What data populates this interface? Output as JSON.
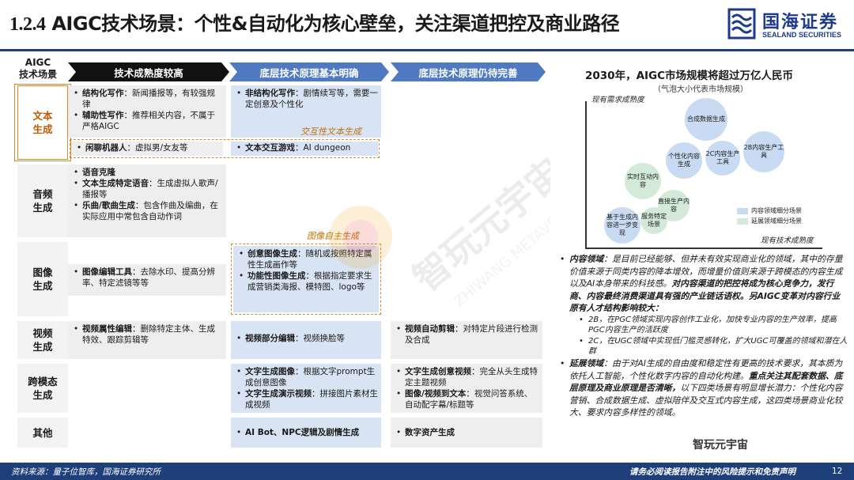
{
  "title": {
    "num": "1.2.4",
    "text": "AIGC技术场景：个性&自动化为核心壁垒，关注渠道把控及商业路径"
  },
  "logo": {
    "cn": "国海证券",
    "en": "SEALAND SECURITIES"
  },
  "table": {
    "corner_label": "AIGC\n技术场景",
    "columns": [
      "技术成熟度较高",
      "底层技术原理基本明确",
      "底层技术原理仍待完善"
    ],
    "rows": [
      "文本\n生成",
      "音频\n生成",
      "图像\n生成",
      "视频\n生成",
      "跨模态\n生成",
      "其他"
    ],
    "text_gen": {
      "c1_items": [
        {
          "bold": "结构化写作",
          "text": "：新闻播报等，有较强规律"
        },
        {
          "bold": "辅助性写作",
          "text": "：推荐相关内容，不属于严格AIGC"
        }
      ],
      "c1_chat": {
        "bold": "闲聊机器人",
        "text": "：虚拟男/女友等"
      },
      "c2_items": [
        {
          "bold": "非结构化写作",
          "text": "：剧情续写等，需要一定创意及个性化"
        }
      ],
      "c2_game": {
        "bold": "文本交互游戏",
        "text": "：AI dungeon"
      },
      "interactive_label": "交互性文本生成"
    },
    "audio_gen": {
      "c1_items": [
        {
          "bold": "语音克隆",
          "text": ""
        },
        {
          "bold": "文本生成特定语音",
          "text": "：生成虚拟人歌声/播报等"
        },
        {
          "bold": "乐曲/歌曲生成",
          "text": "：包含作曲及编曲，在实际应用中常包含自动作词"
        }
      ]
    },
    "image_gen": {
      "auto_label": "图像自主生成",
      "c1_items": [
        {
          "bold": "图像编辑工具",
          "text": "：去除水印、提高分辨率、特定滤镜等等"
        }
      ],
      "c2_items": [
        {
          "bold": "创意图像生成",
          "text": "：随机或按照特定属性生成画作等"
        },
        {
          "bold": "功能性图像生成",
          "text": "：根据指定要求生成营销类海报、模特图、logo等"
        }
      ]
    },
    "video_gen": {
      "c1_items": [
        {
          "bold": "视频属性编辑",
          "text": "：删除特定主体、生成特效、跟踪剪辑等"
        }
      ],
      "c2_items": [
        {
          "bold": "视频部分编辑",
          "text": "：视频换脸等"
        }
      ],
      "c3_items": [
        {
          "bold": "视频自动剪辑",
          "text": "：对特定片段进行检测及合成"
        }
      ]
    },
    "cross_gen": {
      "c2_items": [
        {
          "bold": "文字生成图像",
          "text": "：根据文字prompt生成创意图像"
        },
        {
          "bold": "文字生成演示视频",
          "text": "：拼接图片素材生成视频"
        }
      ],
      "c3_items": [
        {
          "bold": "文字生成创意视频",
          "text": "：完全从头生成特定主题视频"
        },
        {
          "bold": "图像/视频到文本",
          "text": "：视觉问答系统、自动配字幕/标题等"
        }
      ]
    },
    "other": {
      "c2_items": [
        {
          "bold": "AI Bot、NPC逻辑及剧情生成",
          "text": ""
        }
      ],
      "c3_items": [
        {
          "bold": "数字资产生成",
          "text": ""
        }
      ]
    }
  },
  "chart": {
    "title": "2030年，AIGC市场规模将超过万亿人民币",
    "subtitle": "（气泡大小代表市场规模）",
    "ylabel": "现有需求成熟度",
    "xlabel": "现有技术成熟度",
    "legend": [
      "内容领域细分场景",
      "延展领域细分场景"
    ],
    "colors": {
      "content": "#c9dbf2",
      "extend": "#d4ead8"
    }
  },
  "chart_data": {
    "type": "scatter",
    "title": "2030年，AIGC市场规模将超过万亿人民币",
    "subtitle": "（气泡大小代表市场规模）",
    "xlabel": "现有技术成熟度",
    "ylabel": "现有需求成熟度",
    "series": [
      {
        "name": "内容领域细分场景",
        "points": [
          {
            "label": "合成数据生成"
          },
          {
            "label": "2B内容生产工具"
          },
          {
            "label": "个性化内容生成"
          },
          {
            "label": "2C内容生产工具"
          },
          {
            "label": "基于生成内容进一步变现"
          }
        ]
      },
      {
        "name": "延展领域细分场景",
        "points": [
          {
            "label": "实时互动内容"
          },
          {
            "label": "直接生产内容"
          },
          {
            "label": "服务特定场景"
          }
        ]
      }
    ]
  },
  "analysis": {
    "p1_head": "内容领域",
    "p1_body": "：是目前已经能够、但并未有效实现商业化的领域，其中的存量价值来源于同类内容的降本增效，而增量价值则来源于跨模态的内容生成以及AI本身带来的科技感。",
    "p1_bold": "对内容渠道的把控将成为核心竞争力，发行商、内容最终消费渠道具有强的产业链话语权。另AIGC变革对内容行业原有人才结构影响较大：",
    "sub1": "2B，在PGC领域实现内容创作工业化，加快专业内容的生产效率，提高PGC内容生产的活跃度",
    "sub2": "2C，在UGC领域中实现低门槛灵感转化，扩大UGC可覆盖的领域和潜在人群",
    "p2_head": "延展领域",
    "p2_body": "：由于对AI生成的自由度和稳定性有更高的技术要求，其本质为依托人工智能，个性化数字内容的自动化构建。",
    "p2_bold": "重点关注其配套数据、底层原理及商业原理是否清晰，",
    "p2_tail": "以下四类场景有明显增长潜力：个性化内容营销、合成数据生成、虚拟陪伴及交互式内容生成，这四类场景商业化较大、要求内容多样性的领域。"
  },
  "footer": {
    "source": "资料来源：量子位智库，国海证券研究所",
    "disclaimer": "请务必阅读报告附注中的风险提示和免责声明",
    "page": "12"
  },
  "watermark_badge": "智玩元宇宙"
}
